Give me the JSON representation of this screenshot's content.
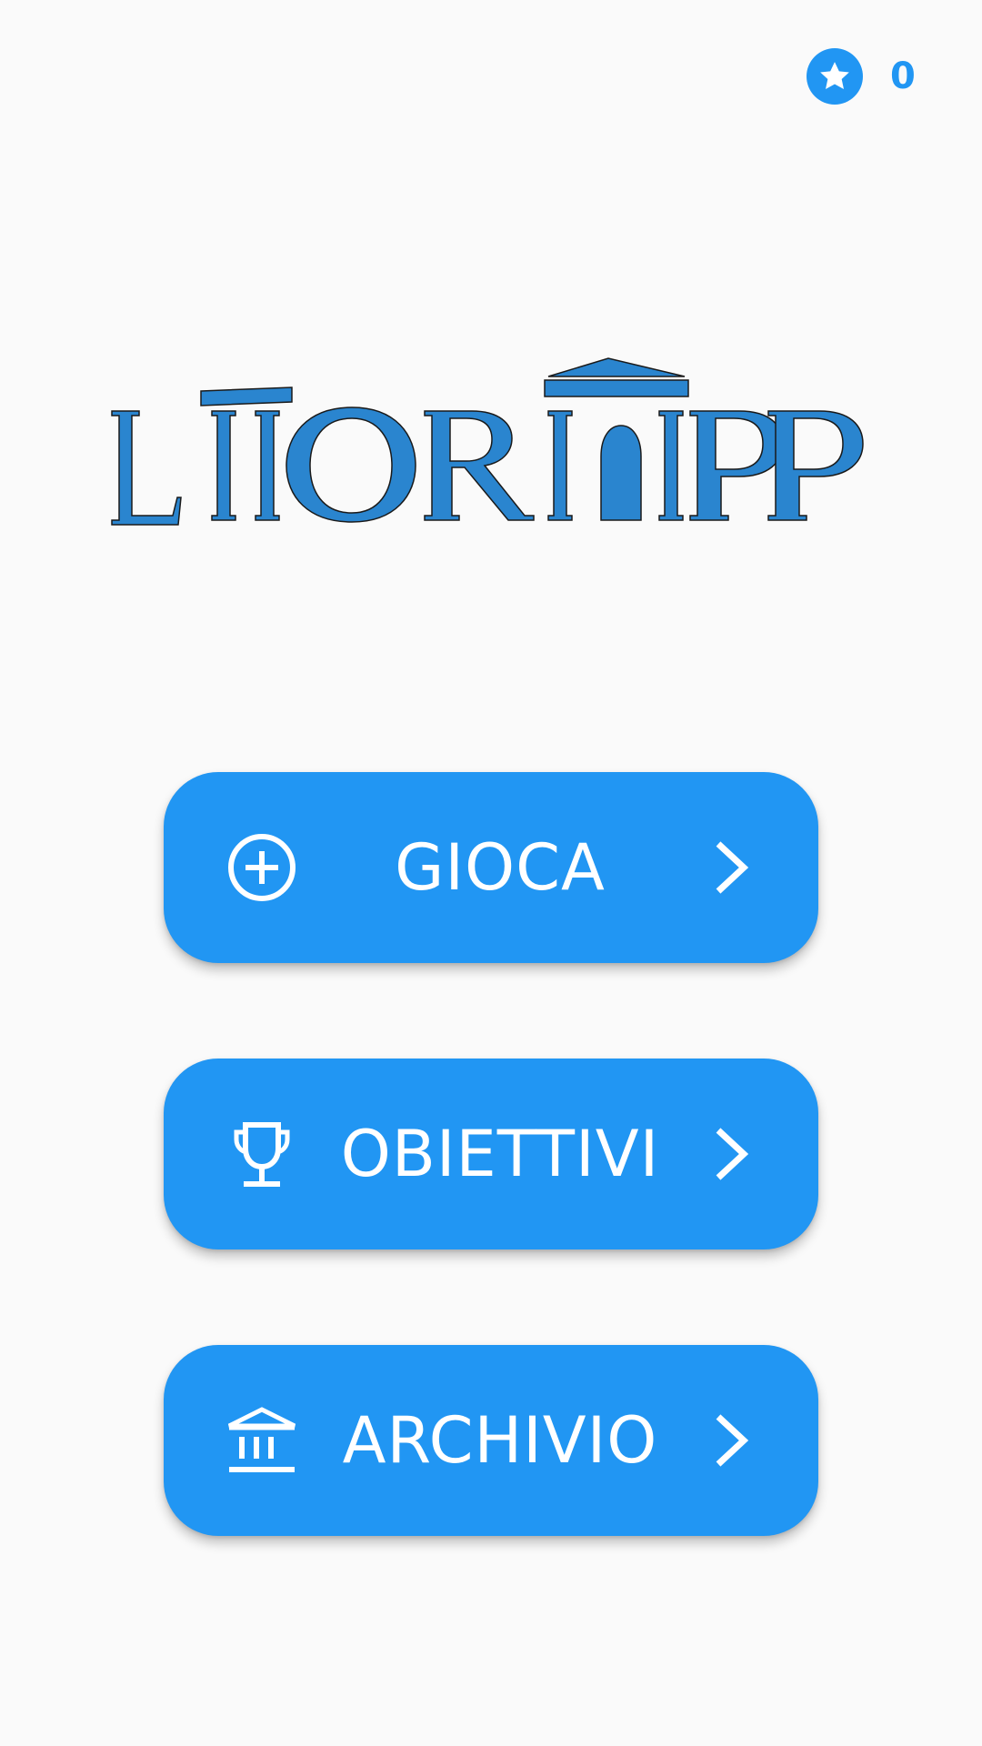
{
  "score": {
    "icon": "star-icon",
    "value": "0"
  },
  "logo": {
    "text": "LITORIAPP",
    "color": "#2a85cf"
  },
  "menu": {
    "play": {
      "label": "GIOCA",
      "icon": "add-circle-icon"
    },
    "goals": {
      "label": "OBIETTIVI",
      "icon": "trophy-icon"
    },
    "archive": {
      "label": "ARCHIVIO",
      "icon": "museum-icon"
    }
  },
  "colors": {
    "accent": "#2196f3",
    "background": "#fafafa",
    "button_text": "#ffffff"
  }
}
